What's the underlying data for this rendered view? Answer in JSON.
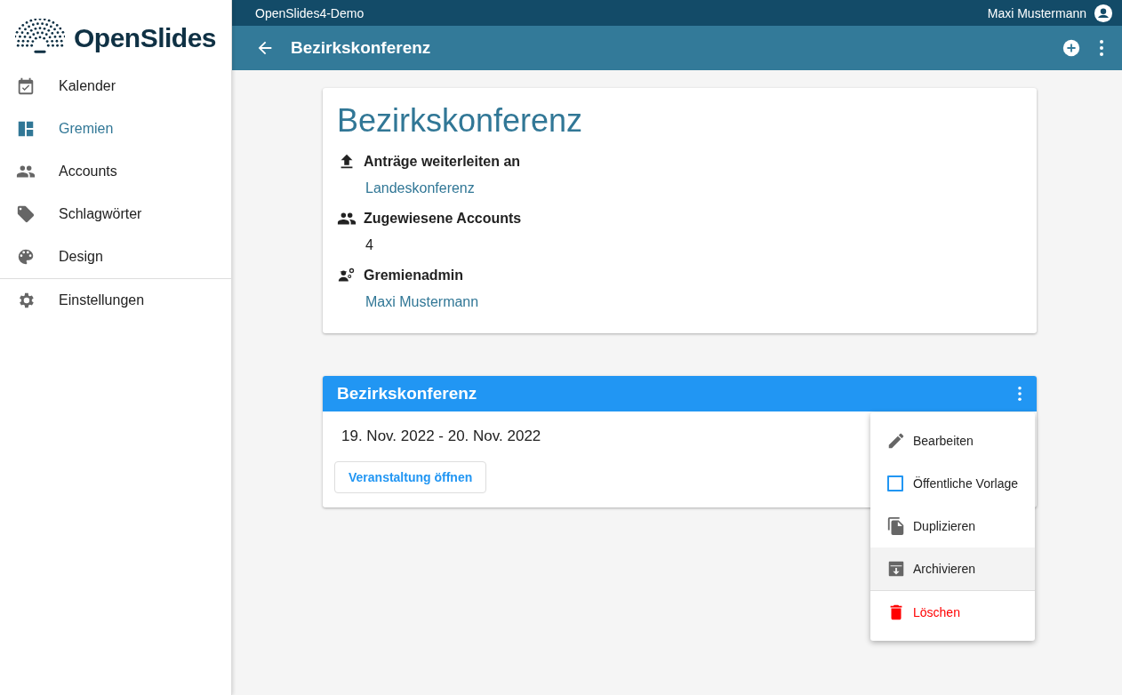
{
  "logo": {
    "text": "OpenSlides"
  },
  "sidebar": {
    "items": [
      {
        "label": "Kalender",
        "selected": false
      },
      {
        "label": "Gremien",
        "selected": true
      },
      {
        "label": "Accounts",
        "selected": false
      },
      {
        "label": "Schlagwörter",
        "selected": false
      },
      {
        "label": "Design",
        "selected": false
      },
      {
        "label": "Einstellungen",
        "selected": false,
        "divider_before": true
      }
    ]
  },
  "top_bar": {
    "title": "OpenSlides4-Demo",
    "user": "Maxi Mustermann"
  },
  "header": {
    "title": "Bezirkskonferenz"
  },
  "committee_card": {
    "title": "Bezirkskonferenz",
    "sections": [
      {
        "heading": "Anträge weiterleiten an",
        "value": "Landeskonferenz",
        "kind": "link"
      },
      {
        "heading": "Zugewiesene Accounts",
        "value": "4",
        "kind": "text"
      },
      {
        "heading": "Gremienadmin",
        "value": "Maxi Mustermann",
        "kind": "link"
      }
    ]
  },
  "meeting_card": {
    "title": "Bezirkskonferenz",
    "dates": "19. Nov. 2022 - 20. Nov. 2022",
    "button": "Veranstaltung öffnen"
  },
  "menu": {
    "items": [
      {
        "label": "Bearbeiten",
        "kind": "action",
        "hovered": false
      },
      {
        "label": "Öffentliche Vorlage",
        "kind": "checkbox",
        "checked": false,
        "hovered": false
      },
      {
        "label": "Duplizieren",
        "kind": "action",
        "hovered": false
      },
      {
        "label": "Archivieren",
        "kind": "action",
        "hovered": true
      },
      {
        "label": "Löschen",
        "kind": "danger",
        "hovered": false,
        "divider_before": true
      }
    ]
  }
}
